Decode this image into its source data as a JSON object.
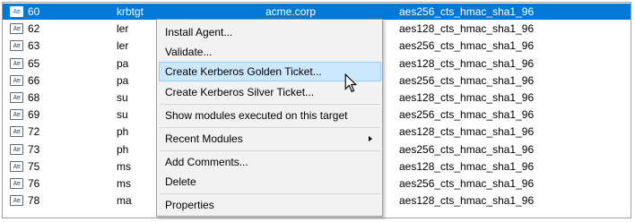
{
  "table": {
    "rows": [
      {
        "id": "60",
        "name": "krbtgt",
        "domain": "acme.corp",
        "enc": "aes256_cts_hmac_sha1_96",
        "selected": true
      },
      {
        "id": "62",
        "name": "ler",
        "domain": "",
        "enc": "aes128_cts_hmac_sha1_96"
      },
      {
        "id": "63",
        "name": "ler",
        "domain": "",
        "enc": "aes256_cts_hmac_sha1_96"
      },
      {
        "id": "65",
        "name": "pa",
        "domain": "",
        "enc": "aes128_cts_hmac_sha1_96"
      },
      {
        "id": "66",
        "name": "pa",
        "domain": "",
        "enc": "aes256_cts_hmac_sha1_96"
      },
      {
        "id": "68",
        "name": "su",
        "domain": "",
        "enc": "aes128_cts_hmac_sha1_96"
      },
      {
        "id": "69",
        "name": "su",
        "domain": "",
        "enc": "aes256_cts_hmac_sha1_96"
      },
      {
        "id": "72",
        "name": "ph",
        "domain": "",
        "enc": "aes128_cts_hmac_sha1_96"
      },
      {
        "id": "73",
        "name": "ph",
        "domain": "",
        "enc": "aes256_cts_hmac_sha1_96"
      },
      {
        "id": "75",
        "name": "ms",
        "domain": "",
        "enc": "aes128_cts_hmac_sha1_96"
      },
      {
        "id": "76",
        "name": "ms",
        "domain": "",
        "enc": "aes256_cts_hmac_sha1_96"
      },
      {
        "id": "78",
        "name": "ma",
        "domain": "",
        "enc": "aes128_cts_hmac_sha1_96"
      }
    ],
    "row_icon": "record-icon",
    "icon_glyph": "A≡"
  },
  "context_menu": {
    "items": {
      "install_agent": "Install Agent...",
      "validate": "Validate...",
      "golden_ticket": "Create Kerberos Golden Ticket...",
      "silver_ticket": "Create Kerberos Silver Ticket...",
      "show_modules": "Show modules executed on this target",
      "recent_modules": "Recent Modules",
      "add_comments": "Add Comments...",
      "delete": "Delete",
      "properties": "Properties"
    },
    "highlighted": "golden_ticket",
    "submenu_icon": "chevron-right-icon"
  },
  "colors": {
    "selection": "#0078d7",
    "menu_background": "#f2f2f2",
    "menu_highlight": "#cce8ff"
  },
  "cursor_icon": "mouse-pointer-icon"
}
